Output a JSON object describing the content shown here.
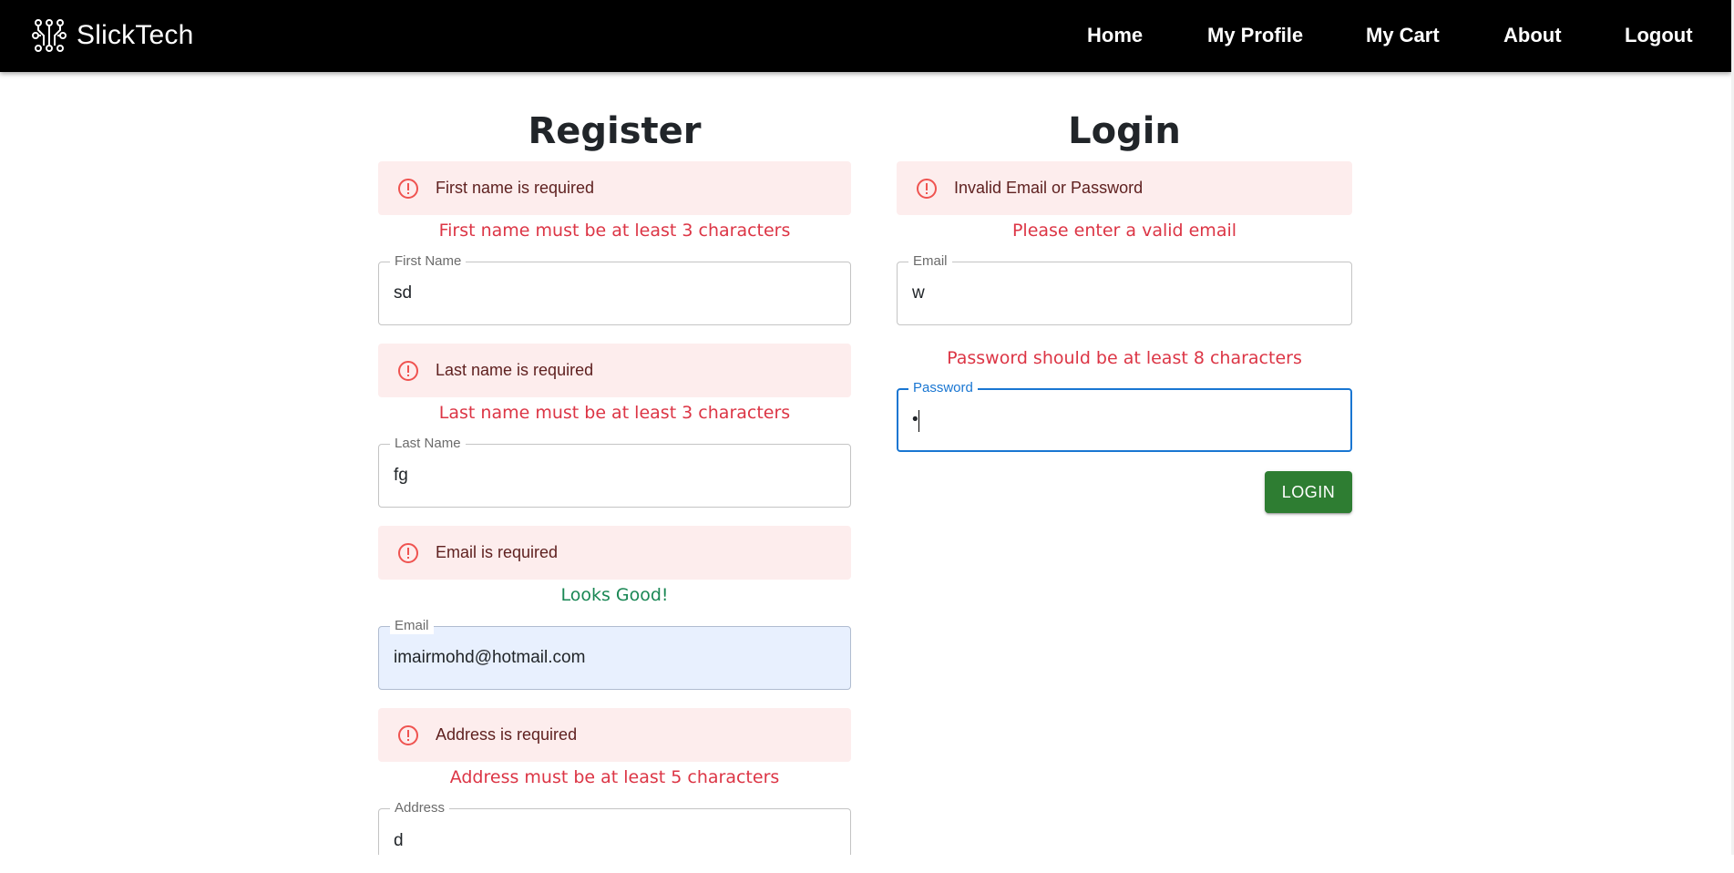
{
  "nav": {
    "brand": "SlickTech",
    "brand_icon": "circuit-logo-icon",
    "links": [
      "Home",
      "My Profile",
      "My Cart",
      "About",
      "Logout"
    ]
  },
  "register": {
    "title": "Register",
    "first_name": {
      "alert": "First name is required",
      "helper": "First name must be at least 3 characters",
      "label": "First Name",
      "value": "sd"
    },
    "last_name": {
      "alert": "Last name is required",
      "helper": "Last name must be at least 3 characters",
      "label": "Last Name",
      "value": "fg"
    },
    "email": {
      "alert": "Email is required",
      "helper": "Looks Good!",
      "label": "Email",
      "value": "imairmohd@hotmail.com"
    },
    "address": {
      "alert": "Address is required",
      "helper": "Address must be at least 5 characters",
      "label": "Address",
      "value": "d"
    }
  },
  "login": {
    "title": "Login",
    "alert": "Invalid Email or Password",
    "email": {
      "helper": "Please enter a valid email",
      "label": "Email",
      "value": "w"
    },
    "password": {
      "helper": "Password should be at least 8 characters",
      "label": "Password",
      "value": "•"
    },
    "button": "LOGIN"
  },
  "colors": {
    "navbar": "#000000",
    "alert_bg": "#fdeded",
    "alert_icon": "#ef5350",
    "error_text": "#dc3545",
    "success_text": "#198754",
    "focus": "#1976d2",
    "login_button": "#2e7d32"
  },
  "icons": {
    "alert": "error-outline-icon"
  }
}
